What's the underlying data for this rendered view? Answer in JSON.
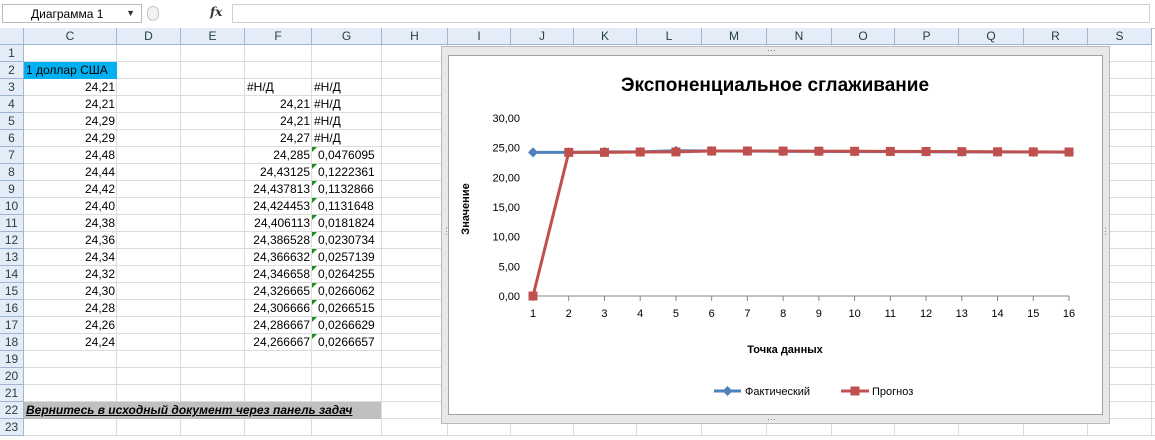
{
  "formula_bar": {
    "name_box": "Диаграмма 1",
    "fx": "fx",
    "formula": ""
  },
  "columns": [
    "C",
    "D",
    "E",
    "F",
    "G",
    "H",
    "I",
    "J",
    "K",
    "L",
    "M",
    "N",
    "O",
    "P",
    "Q",
    "R",
    "S"
  ],
  "rows": [
    "1",
    "2",
    "3",
    "4",
    "5",
    "6",
    "7",
    "8",
    "9",
    "10",
    "11",
    "12",
    "13",
    "14",
    "15",
    "16",
    "17",
    "18",
    "19",
    "20",
    "21",
    "22",
    "23"
  ],
  "cells": {
    "c2": "1 доллар США",
    "c_values": [
      "24,21",
      "24,21",
      "24,29",
      "24,29",
      "24,48",
      "24,44",
      "24,42",
      "24,40",
      "24,38",
      "24,36",
      "24,34",
      "24,32",
      "24,30",
      "24,28",
      "24,26",
      "24,24"
    ],
    "f_values": [
      "#Н/Д",
      "24,21",
      "24,21",
      "24,27",
      "24,285",
      "24,43125",
      "24,437813",
      "24,424453",
      "24,406113",
      "24,386528",
      "24,366632",
      "24,346658",
      "24,326665",
      "24,306666",
      "24,286667",
      "24,266667"
    ],
    "g_values": [
      "#Н/Д",
      "#Н/Д",
      "#Н/Д",
      "#Н/Д",
      "0,0476095",
      "0,1222361",
      "0,1132866",
      "0,1131648",
      "0,0181824",
      "0,0230734",
      "0,0257139",
      "0,0264255",
      "0,0266062",
      "0,0266515",
      "0,0266629",
      "0,0266657"
    ],
    "c22": "Вернитесь в исходный документ через панель задач"
  },
  "colors": {
    "c2_fill": "#00b0f0",
    "actual": "#4f81bd",
    "forecast": "#c0504d",
    "c22_fill": "#c0c0c0"
  },
  "chart_data": {
    "type": "line",
    "title": "Экспоненциальное сглаживание",
    "xlabel": "Точка данных",
    "ylabel": "Значение",
    "categories": [
      "1",
      "2",
      "3",
      "4",
      "5",
      "6",
      "7",
      "8",
      "9",
      "10",
      "11",
      "12",
      "13",
      "14",
      "15",
      "16"
    ],
    "ylim": [
      0,
      30
    ],
    "yticks": [
      "0,00",
      "5,00",
      "10,00",
      "15,00",
      "20,00",
      "25,00",
      "30,00"
    ],
    "legend": "bottom",
    "series": [
      {
        "name": "Фактический",
        "values": [
          24.21,
          24.21,
          24.29,
          24.29,
          24.48,
          24.44,
          24.42,
          24.4,
          24.38,
          24.36,
          24.34,
          24.32,
          24.3,
          24.28,
          24.26,
          24.24
        ]
      },
      {
        "name": "Прогноз",
        "values": [
          0,
          24.21,
          24.21,
          24.27,
          24.285,
          24.43125,
          24.437813,
          24.424453,
          24.406113,
          24.386528,
          24.366632,
          24.346658,
          24.326665,
          24.306666,
          24.286667,
          24.266667
        ]
      }
    ]
  }
}
